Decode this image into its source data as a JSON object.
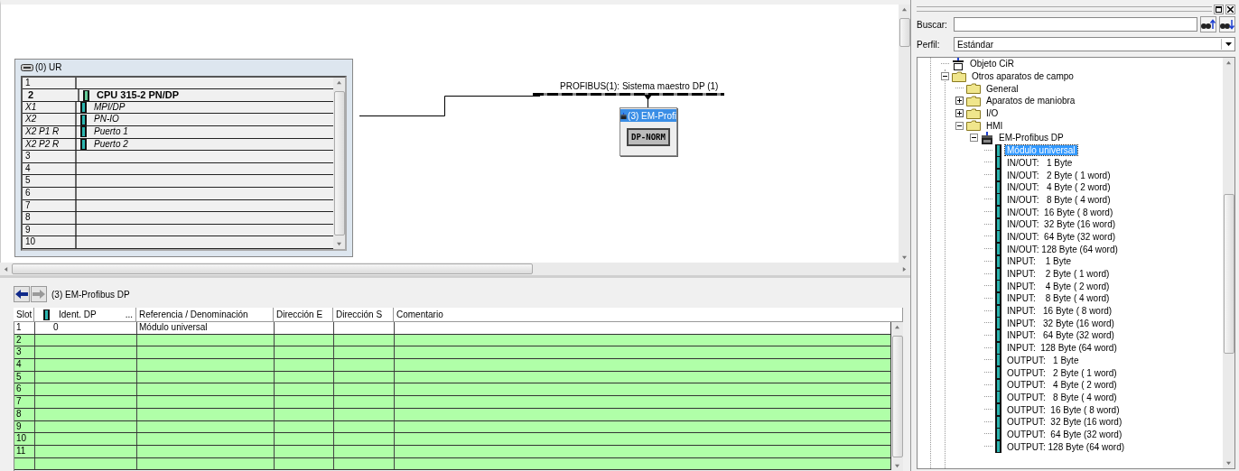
{
  "diagram": {
    "rack": {
      "title": "(0) UR",
      "rows": [
        {
          "slot": "1",
          "kind": "empty"
        },
        {
          "slot": "2",
          "module": "CPU 315-2 PN/DP",
          "kind": "cpu"
        },
        {
          "slot": "X1",
          "module": "MPI/DP",
          "kind": "interface"
        },
        {
          "slot": "X2",
          "module": "PN-IO",
          "kind": "interface"
        },
        {
          "slot": "X2 P1 R",
          "module": "Puerto 1",
          "kind": "interface"
        },
        {
          "slot": "X2 P2 R",
          "module": "Puerto 2",
          "kind": "interface"
        },
        {
          "slot": "3",
          "kind": "empty"
        },
        {
          "slot": "4",
          "kind": "empty"
        },
        {
          "slot": "5",
          "kind": "empty"
        },
        {
          "slot": "6",
          "kind": "empty"
        },
        {
          "slot": "7",
          "kind": "empty"
        },
        {
          "slot": "8",
          "kind": "empty"
        },
        {
          "slot": "9",
          "kind": "empty"
        },
        {
          "slot": "10",
          "kind": "empty"
        }
      ]
    },
    "bus": {
      "label": "PROFIBUS(1): Sistema maestro DP (1)"
    },
    "station": {
      "title": "(3) EM-Profi",
      "module": "DP-NORM"
    }
  },
  "detail": {
    "title": "(3)  EM-Profibus DP",
    "columns": [
      "Slot",
      "Ident. DP",
      "Referencia / Denominación",
      "Dirección E",
      "Dirección S",
      "Comentario"
    ],
    "ident_button": "...",
    "rows": [
      {
        "slot": "1",
        "ident": "0",
        "reference": "Módulo universal",
        "free": false
      },
      {
        "slot": "2",
        "free": true
      },
      {
        "slot": "3",
        "free": true
      },
      {
        "slot": "4",
        "free": true
      },
      {
        "slot": "5",
        "free": true
      },
      {
        "slot": "6",
        "free": true
      },
      {
        "slot": "7",
        "free": true
      },
      {
        "slot": "8",
        "free": true
      },
      {
        "slot": "9",
        "free": true
      },
      {
        "slot": "10",
        "free": true
      },
      {
        "slot": "11",
        "free": true
      }
    ]
  },
  "catalog": {
    "search_label": "Buscar:",
    "profile_label": "Perfil:",
    "profile": "Estándar",
    "tree": [
      {
        "label": "Objeto CiR",
        "kind": "cir",
        "selected": false
      },
      {
        "label": "Otros aparatos de campo",
        "kind": "folder",
        "expanded": true,
        "selected": false,
        "children": [
          {
            "label": "General",
            "kind": "folder",
            "selected": false
          },
          {
            "label": "Aparatos de maniobra",
            "kind": "folder",
            "expanded": false,
            "selected": false
          },
          {
            "label": "I/O",
            "kind": "folder",
            "expanded": false,
            "selected": false
          },
          {
            "label": "HMI",
            "kind": "folder",
            "expanded": true,
            "selected": false,
            "children": [
              {
                "label": "EM-Profibus DP",
                "kind": "device",
                "expanded": true,
                "selected": false,
                "children": [
                  {
                    "label": "Módulo universal",
                    "kind": "module",
                    "selected": true
                  },
                  {
                    "label": "IN/OUT:   1 Byte",
                    "kind": "module",
                    "selected": false
                  },
                  {
                    "label": "IN/OUT:   2 Byte ( 1 word)",
                    "kind": "module",
                    "selected": false
                  },
                  {
                    "label": "IN/OUT:   4 Byte ( 2 word)",
                    "kind": "module",
                    "selected": false
                  },
                  {
                    "label": "IN/OUT:   8 Byte ( 4 word)",
                    "kind": "module",
                    "selected": false
                  },
                  {
                    "label": "IN/OUT:  16 Byte ( 8 word)",
                    "kind": "module",
                    "selected": false
                  },
                  {
                    "label": "IN/OUT:  32 Byte (16 word)",
                    "kind": "module",
                    "selected": false
                  },
                  {
                    "label": "IN/OUT:  64 Byte (32 word)",
                    "kind": "module",
                    "selected": false
                  },
                  {
                    "label": "IN/OUT: 128 Byte (64 word)",
                    "kind": "module",
                    "selected": false
                  },
                  {
                    "label": "INPUT:    1 Byte",
                    "kind": "module",
                    "selected": false
                  },
                  {
                    "label": "INPUT:    2 Byte ( 1 word)",
                    "kind": "module",
                    "selected": false
                  },
                  {
                    "label": "INPUT:    4 Byte ( 2 word)",
                    "kind": "module",
                    "selected": false
                  },
                  {
                    "label": "INPUT:    8 Byte ( 4 word)",
                    "kind": "module",
                    "selected": false
                  },
                  {
                    "label": "INPUT:   16 Byte ( 8 word)",
                    "kind": "module",
                    "selected": false
                  },
                  {
                    "label": "INPUT:   32 Byte (16 word)",
                    "kind": "module",
                    "selected": false
                  },
                  {
                    "label": "INPUT:   64 Byte (32 word)",
                    "kind": "module",
                    "selected": false
                  },
                  {
                    "label": "INPUT:  128 Byte (64 word)",
                    "kind": "module",
                    "selected": false
                  },
                  {
                    "label": "OUTPUT:   1 Byte",
                    "kind": "module",
                    "selected": false
                  },
                  {
                    "label": "OUTPUT:   2 Byte ( 1 word)",
                    "kind": "module",
                    "selected": false
                  },
                  {
                    "label": "OUTPUT:   4 Byte ( 2 word)",
                    "kind": "module",
                    "selected": false
                  },
                  {
                    "label": "OUTPUT:   8 Byte ( 4 word)",
                    "kind": "module",
                    "selected": false
                  },
                  {
                    "label": "OUTPUT:  16 Byte ( 8 word)",
                    "kind": "module",
                    "selected": false
                  },
                  {
                    "label": "OUTPUT:  32 Byte (16 word)",
                    "kind": "module",
                    "selected": false
                  },
                  {
                    "label": "OUTPUT:  64 Byte (32 word)",
                    "kind": "module",
                    "selected": false
                  },
                  {
                    "label": "OUTPUT: 128 Byte (64 word)",
                    "kind": "module",
                    "selected": false
                  }
                ]
              }
            ]
          }
        ]
      }
    ]
  }
}
